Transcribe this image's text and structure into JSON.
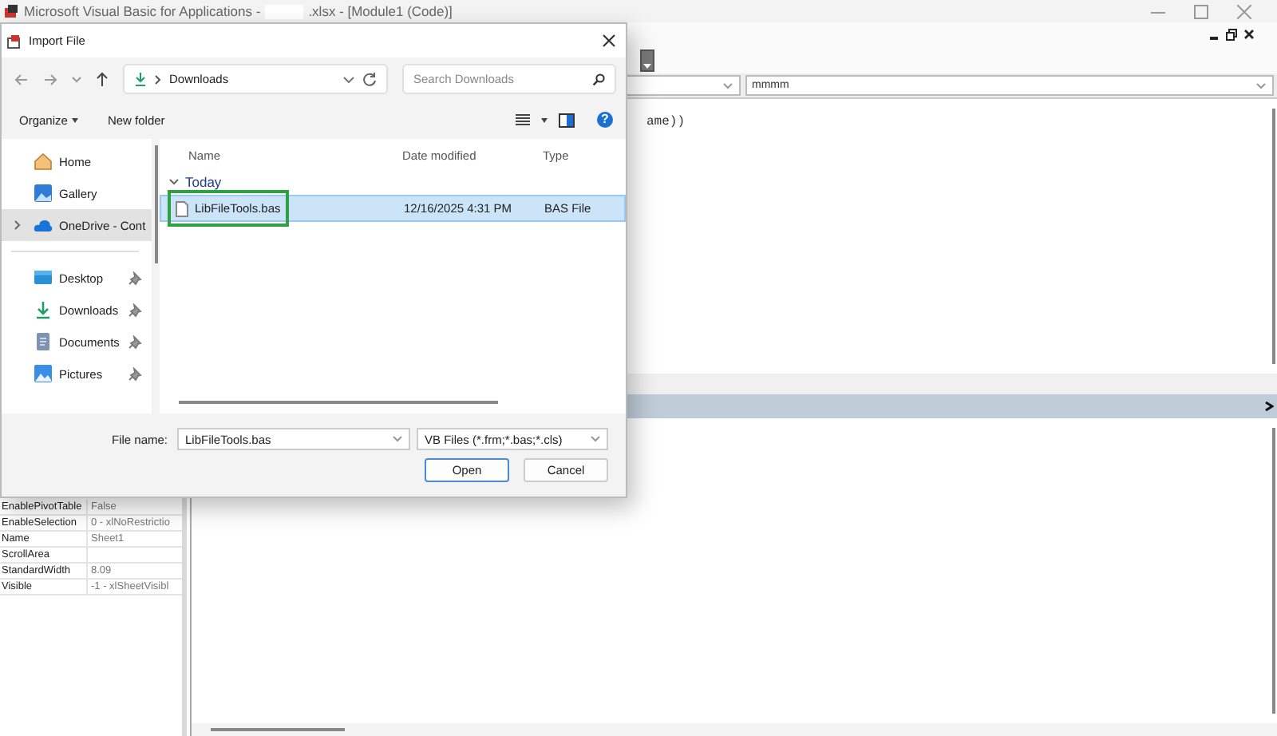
{
  "app_window": {
    "title_start": "Microsoft Visual Basic for Applications -",
    "title_end": ".xlsx - [Module1 (Code)]"
  },
  "code_window": {
    "procedure_dropdown": "mmmm",
    "code_fragment": "ame))"
  },
  "properties": [
    {
      "name": "EnablePivotTable",
      "value": "False"
    },
    {
      "name": "EnableSelection",
      "value": "0 - xlNoRestrictio"
    },
    {
      "name": "Name",
      "value": "Sheet1"
    },
    {
      "name": "ScrollArea"
    },
    {
      "name": "StandardWidth",
      "value": "8.09"
    },
    {
      "name": "Visible",
      "value": "-1 - xlSheetVisibl"
    }
  ],
  "dialog": {
    "title": "Import File",
    "address": "Downloads",
    "search_placeholder": "Search Downloads",
    "commands": [
      "Organize",
      "New folder"
    ],
    "help": "?",
    "nav_items": [
      {
        "label": "Home",
        "kind": "home",
        "selected": false,
        "pinned": false,
        "expandable": false
      },
      {
        "label": "Gallery",
        "kind": "gallery",
        "selected": false,
        "pinned": false,
        "expandable": false
      },
      {
        "label": "OneDrive - Cont",
        "kind": "cloud",
        "selected": true,
        "pinned": false,
        "expandable": true
      },
      {
        "label": "Desktop",
        "kind": "desktop",
        "selected": false,
        "pinned": true,
        "expandable": false
      },
      {
        "label": "Downloads",
        "kind": "downloads",
        "selected": false,
        "pinned": true,
        "expandable": false
      },
      {
        "label": "Documents",
        "kind": "documents",
        "selected": false,
        "pinned": true,
        "expandable": false
      },
      {
        "label": "Pictures",
        "kind": "pictures",
        "selected": false,
        "pinned": true,
        "expandable": false
      }
    ],
    "columns": [
      "Name",
      "Date modified",
      "Type"
    ],
    "group": "Today",
    "files": [
      {
        "name": "LibFileTools.bas",
        "date": "12/16/2025 4:31 PM",
        "type": "BAS File",
        "selected": true,
        "highlighted": true
      }
    ],
    "file_name_label": "File name:",
    "file_name": "LibFileTools.bas",
    "file_type": "VB Files (*.frm;*.bas;*.cls)",
    "buttons": [
      "Open",
      "Cancel"
    ]
  }
}
